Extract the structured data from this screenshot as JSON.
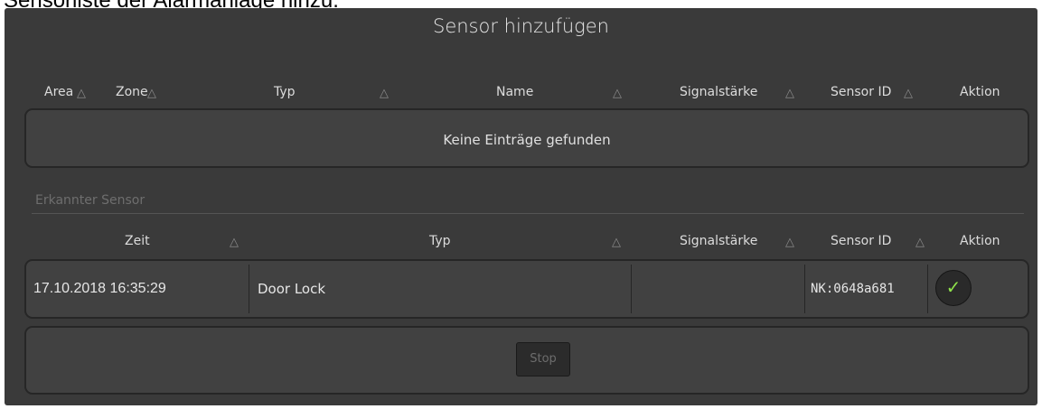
{
  "page_caption": "Sensorliste der Alarmanlage hinzu.",
  "dialog": {
    "title": "Sensor hinzufügen"
  },
  "sensor_table": {
    "headers": [
      "Area",
      "Zone",
      "Typ",
      "Name",
      "Signalstärke",
      "Sensor ID",
      "Aktion"
    ],
    "empty_message": "Keine Einträge gefunden"
  },
  "detected": {
    "section_label": "Erkannter Sensor",
    "headers": [
      "Zeit",
      "Typ",
      "Signalstärke",
      "Sensor ID",
      "Aktion"
    ],
    "rows": [
      {
        "time": "17.10.2018 16:35:29",
        "type": "Door Lock",
        "signal": "",
        "sensor_id": "NK:0648a681",
        "action_icon": "✓"
      }
    ]
  },
  "stop_button": "Stop",
  "icons": {
    "sort": "△",
    "confirm": "check-icon"
  },
  "colors": {
    "panel": "#3a3a3a",
    "box": "#414141",
    "confirm_check": "#8fe24a"
  }
}
